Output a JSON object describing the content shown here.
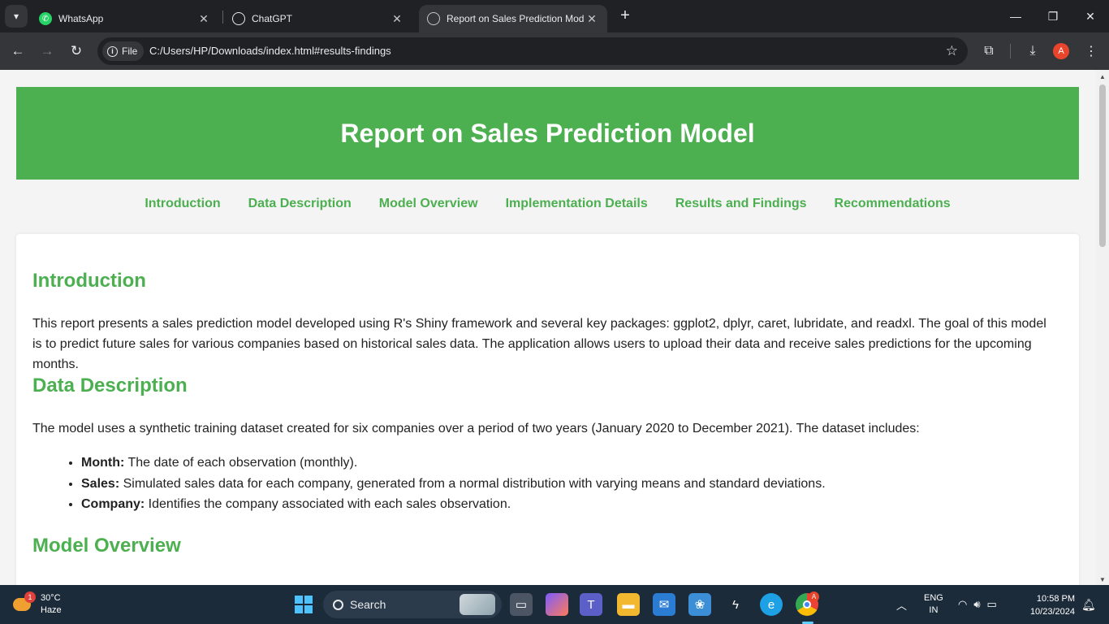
{
  "browser": {
    "tabs": [
      {
        "title": "WhatsApp",
        "icon": "whatsapp-icon"
      },
      {
        "title": "ChatGPT",
        "icon": "chatgpt-icon"
      },
      {
        "title": "Report on Sales Prediction Mod",
        "icon": "globe-icon",
        "active": true
      }
    ],
    "address_chip": "File",
    "url": "C:/Users/HP/Downloads/index.html#results-findings",
    "profile_initial": "A"
  },
  "page": {
    "title": "Report on Sales Prediction Model",
    "nav": [
      "Introduction",
      "Data Description",
      "Model Overview",
      "Implementation Details",
      "Results and Findings",
      "Recommendations"
    ],
    "sections": {
      "introduction": {
        "heading": "Introduction",
        "text": "This report presents a sales prediction model developed using R's Shiny framework and several key packages: ggplot2, dplyr, caret, lubridate, and readxl. The goal of this model is to predict future sales for various companies based on historical sales data. The application allows users to upload their data and receive sales predictions for the upcoming months."
      },
      "data_description": {
        "heading": "Data Description",
        "text": "The model uses a synthetic training dataset created for six companies over a period of two years (January 2020 to December 2021). The dataset includes:",
        "items": [
          {
            "term": "Month:",
            "desc": " The date of each observation (monthly)."
          },
          {
            "term": "Sales:",
            "desc": " Simulated sales data for each company, generated from a normal distribution with varying means and standard deviations."
          },
          {
            "term": "Company:",
            "desc": " Identifies the company associated with each sales observation."
          }
        ]
      },
      "model_overview": {
        "heading": "Model Overview"
      }
    }
  },
  "taskbar": {
    "weather_temp": "30°C",
    "weather_cond": "Haze",
    "weather_badge": "1",
    "search_label": "Search",
    "language": "ENG",
    "region": "IN",
    "time": "10:58 PM",
    "date": "10/23/2024",
    "chrome_badge": "A"
  },
  "colors": {
    "accent_green": "#4caf50",
    "tab_bg": "#202124",
    "toolbar_bg": "#35363a",
    "taskbar_bg": "#1c2b3a"
  }
}
